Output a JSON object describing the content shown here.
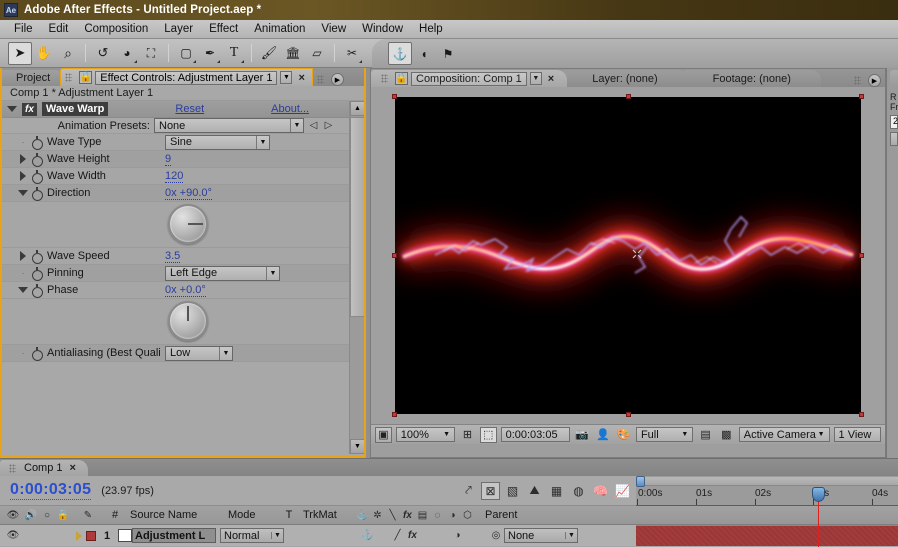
{
  "window": {
    "app_icon": "Ae",
    "title": "Adobe After Effects - Untitled Project.aep *"
  },
  "menubar": {
    "items": [
      "File",
      "Edit",
      "Composition",
      "Layer",
      "Effect",
      "Animation",
      "View",
      "Window",
      "Help"
    ]
  },
  "toolbar": {
    "tools": [
      {
        "name": "selection-tool",
        "glyph": "➤",
        "selected": true,
        "corner": false
      },
      {
        "name": "hand-tool",
        "glyph": "✋",
        "selected": false,
        "corner": false
      },
      {
        "name": "zoom-tool",
        "glyph": "⌕",
        "selected": false,
        "corner": false
      },
      {
        "name": "rotation-tool",
        "glyph": "↺",
        "selected": false,
        "corner": false
      },
      {
        "name": "orbit-camera-tool",
        "glyph": "◔",
        "selected": false,
        "corner": true
      },
      {
        "name": "pan-behind-tool",
        "glyph": "⯀",
        "selected": false,
        "corner": false
      },
      {
        "name": "shape-tool",
        "glyph": "□",
        "selected": false,
        "corner": true
      },
      {
        "name": "pen-tool",
        "glyph": "✒",
        "selected": false,
        "corner": true
      },
      {
        "name": "type-tool",
        "glyph": "T",
        "selected": false,
        "corner": true
      },
      {
        "name": "brush-tool",
        "glyph": "╱",
        "selected": false,
        "corner": false
      },
      {
        "name": "clone-stamp-tool",
        "glyph": "⚙",
        "selected": false,
        "corner": false
      },
      {
        "name": "eraser-tool",
        "glyph": "▱",
        "selected": false,
        "corner": false
      },
      {
        "name": "roto-brush-tool",
        "glyph": "✄",
        "selected": false,
        "corner": true
      }
    ],
    "right_tools": [
      {
        "name": "anchor-point-tool",
        "glyph": "⚓",
        "selected": true
      },
      {
        "name": "mask-feather-tool",
        "glyph": "◑",
        "selected": false
      },
      {
        "name": "puppet-pin-tool",
        "glyph": "⚑",
        "selected": false
      }
    ]
  },
  "effect_controls": {
    "tab_project": "Project",
    "tab_active": "Effect Controls: Adjustment Layer 1",
    "subheader": "Comp 1 * Adjustment Layer 1",
    "effect_name": "Wave Warp",
    "fx_badge": "fx",
    "reset_label": "Reset",
    "about_label": "About...",
    "animation_presets_label": "Animation Presets:",
    "animation_presets_value": "None",
    "properties": [
      {
        "name": "wave-type",
        "label": "Wave Type",
        "value": "Sine",
        "type": "dropdown",
        "twirl": "none"
      },
      {
        "name": "wave-height",
        "label": "Wave Height",
        "value": "9",
        "type": "number",
        "twirl": "right"
      },
      {
        "name": "wave-width",
        "label": "Wave Width",
        "value": "120",
        "type": "number",
        "twirl": "right"
      },
      {
        "name": "direction",
        "label": "Direction",
        "value": "0x +90.0°",
        "type": "angle",
        "twirl": "down",
        "dial_angle": 90
      },
      {
        "name": "wave-speed",
        "label": "Wave Speed",
        "value": "3.5",
        "type": "number",
        "twirl": "right"
      },
      {
        "name": "pinning",
        "label": "Pinning",
        "value": "Left Edge",
        "type": "dropdown",
        "twirl": "none"
      },
      {
        "name": "phase",
        "label": "Phase",
        "value": "0x +0.0°",
        "type": "angle",
        "twirl": "down",
        "dial_angle": 0
      },
      {
        "name": "antialiasing",
        "label": "Antialiasing (Best Quali",
        "value": "Low",
        "type": "dropdown",
        "twirl": "none"
      }
    ]
  },
  "composition": {
    "tabs": [
      {
        "name": "tab-composition",
        "label": "Composition: Comp 1",
        "active": true,
        "closable": true
      },
      {
        "name": "tab-layer",
        "label": "Layer: (none)",
        "active": false,
        "closable": false
      },
      {
        "name": "tab-footage",
        "label": "Footage: (none)",
        "active": false,
        "closable": false
      }
    ],
    "footer": {
      "zoom": "100%",
      "time": "0:00:03:05",
      "resolution": "Full",
      "camera": "Active Camera",
      "views": "1 View"
    },
    "canvas": {
      "background": "#000000",
      "effect": "wave-warp-lightning",
      "glow_core": "#ffffff",
      "glow_mid": "#ff7b1c",
      "glow_outer": "#c41010",
      "spark_color": "#a08bff"
    }
  },
  "right_dock": {
    "field_value": "2",
    "labels": [
      "R",
      "Fr"
    ]
  },
  "timeline": {
    "tab_label": "Comp 1",
    "current_time": "0:00:03:05",
    "fps": "(23.97 fps)",
    "buttons": [
      {
        "name": "live-update-button",
        "glyph": "➦",
        "selected": false
      },
      {
        "name": "draft-3d-button",
        "glyph": "⌧",
        "selected": true
      },
      {
        "name": "hide-shy-layers-button",
        "glyph": "▧",
        "selected": false
      },
      {
        "name": "frame-blending-button",
        "glyph": "▤",
        "selected": false
      },
      {
        "name": "motion-blur-button",
        "glyph": "▒",
        "selected": false
      },
      {
        "name": "brainstorm-button",
        "glyph": "●",
        "selected": false
      },
      {
        "name": "auto-keyframe-button",
        "glyph": "⚙",
        "selected": false
      },
      {
        "name": "graph-editor-button",
        "glyph": "↗",
        "selected": false
      }
    ],
    "columns": [
      {
        "name": "col-video",
        "label": "👁"
      },
      {
        "name": "col-audio",
        "label": "🔊"
      },
      {
        "name": "col-solo",
        "label": "○"
      },
      {
        "name": "col-lock",
        "label": "🔒"
      },
      {
        "name": "col-label",
        "label": "✎"
      },
      {
        "name": "col-number",
        "label": "#"
      },
      {
        "name": "col-source-name",
        "label": "Source Name"
      },
      {
        "name": "col-mode",
        "label": "Mode"
      },
      {
        "name": "col-t",
        "label": "T"
      },
      {
        "name": "col-trkmat",
        "label": "TrkMat"
      },
      {
        "name": "col-parent",
        "label": "Parent"
      }
    ],
    "switch_icons": [
      "⚓",
      "☀",
      "╲",
      "fx",
      "▤",
      "○",
      "◑",
      "⬡"
    ],
    "layers": [
      {
        "name": "layer-row-1",
        "index": "1",
        "source_name": "Adjustment L",
        "mode": "Normal",
        "parent": "None",
        "label_color": "#b03a3a",
        "bar_color": "#a33c3c"
      }
    ],
    "ruler": {
      "ticks": [
        "0:00s",
        "01s",
        "02s",
        "03s",
        "04s"
      ],
      "playhead_time": "03s"
    }
  }
}
